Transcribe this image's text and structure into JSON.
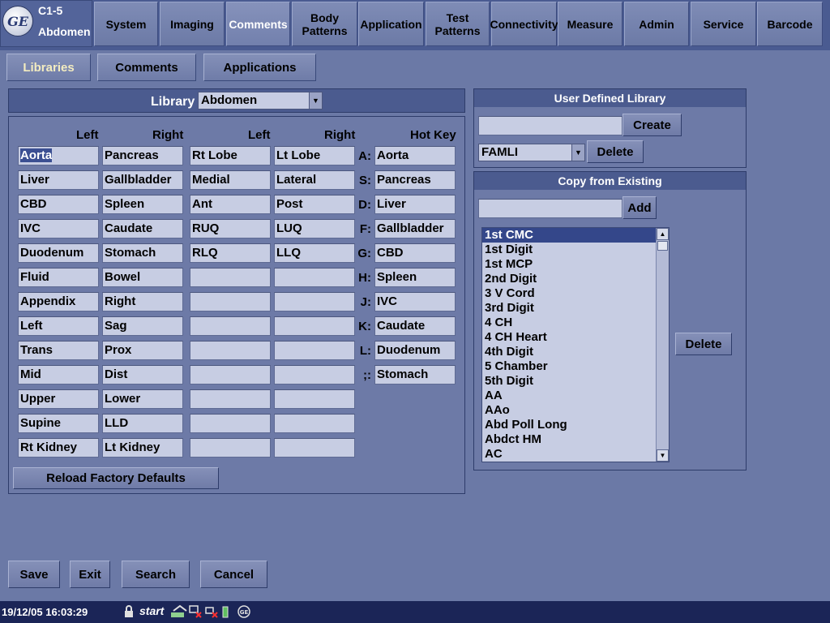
{
  "probe": {
    "name": "C1-5",
    "preset": "Abdomen"
  },
  "top_tabs": [
    {
      "label": "System"
    },
    {
      "label": "Imaging"
    },
    {
      "label": "Comments"
    },
    {
      "label": "Body\nPatterns"
    },
    {
      "label": "Application"
    },
    {
      "label": "Test\nPatterns"
    },
    {
      "label": "Connectivity"
    },
    {
      "label": "Measure"
    },
    {
      "label": "Admin"
    },
    {
      "label": "Service"
    },
    {
      "label": "Barcode"
    }
  ],
  "active_top_tab": "Comments",
  "sub_tabs": [
    {
      "label": "Libraries"
    },
    {
      "label": "Comments"
    },
    {
      "label": "Applications"
    }
  ],
  "library": {
    "label": "Library",
    "selected": "Abdomen",
    "headers": [
      "Left",
      "Right",
      "Left",
      "Right",
      "Hot Key"
    ],
    "col1": [
      "Aorta",
      "Liver",
      "CBD",
      "IVC",
      "Duodenum",
      "Fluid",
      "Appendix",
      "Left",
      "Trans",
      "Mid",
      "Upper",
      "Supine",
      "Rt Kidney"
    ],
    "col2": [
      "Pancreas",
      "Gallbladder",
      "Spleen",
      "Caudate",
      "Stomach",
      "Bowel",
      "Right",
      "Sag",
      "Prox",
      "Dist",
      "Lower",
      "LLD",
      "Lt Kidney"
    ],
    "col3": [
      "Rt Lobe",
      "Medial",
      "Ant",
      "RUQ",
      "RLQ",
      "",
      "",
      "",
      "",
      "",
      "",
      "",
      ""
    ],
    "col4": [
      "Lt Lobe",
      "Lateral",
      "Post",
      "LUQ",
      "LLQ",
      "",
      "",
      "",
      "",
      "",
      "",
      "",
      ""
    ],
    "hotkeys": [
      {
        "key": "A:",
        "value": "Aorta"
      },
      {
        "key": "S:",
        "value": "Pancreas"
      },
      {
        "key": "D:",
        "value": "Liver"
      },
      {
        "key": "F:",
        "value": "Gallbladder"
      },
      {
        "key": "G:",
        "value": "CBD"
      },
      {
        "key": "H:",
        "value": "Spleen"
      },
      {
        "key": "J:",
        "value": "IVC"
      },
      {
        "key": "K:",
        "value": "Caudate"
      },
      {
        "key": "L:",
        "value": "Duodenum"
      },
      {
        "key": ";:",
        "value": "Stomach"
      }
    ],
    "reload_label": "Reload Factory Defaults"
  },
  "user_library": {
    "title": "User Defined Library",
    "input_value": "",
    "create_label": "Create",
    "selected": "FAMLI",
    "delete_label": "Delete"
  },
  "copy_existing": {
    "title": "Copy from Existing",
    "input_value": "",
    "add_label": "Add",
    "delete_label": "Delete",
    "items": [
      "1st CMC",
      "1st Digit",
      "1st MCP",
      "2nd Digit",
      "3 V Cord",
      "3rd Digit",
      "4 CH",
      "4 CH Heart",
      "4th Digit",
      "5 Chamber",
      "5th Digit",
      "AA",
      "AAo",
      "Abd Poll Long",
      "Abdct HM",
      "AC"
    ],
    "selected_index": 0
  },
  "bottom_buttons": {
    "save": "Save",
    "exit": "Exit",
    "search": "Search",
    "cancel": "Cancel"
  },
  "status": {
    "datetime": "19/12/05 16:03:29",
    "start": "start"
  }
}
